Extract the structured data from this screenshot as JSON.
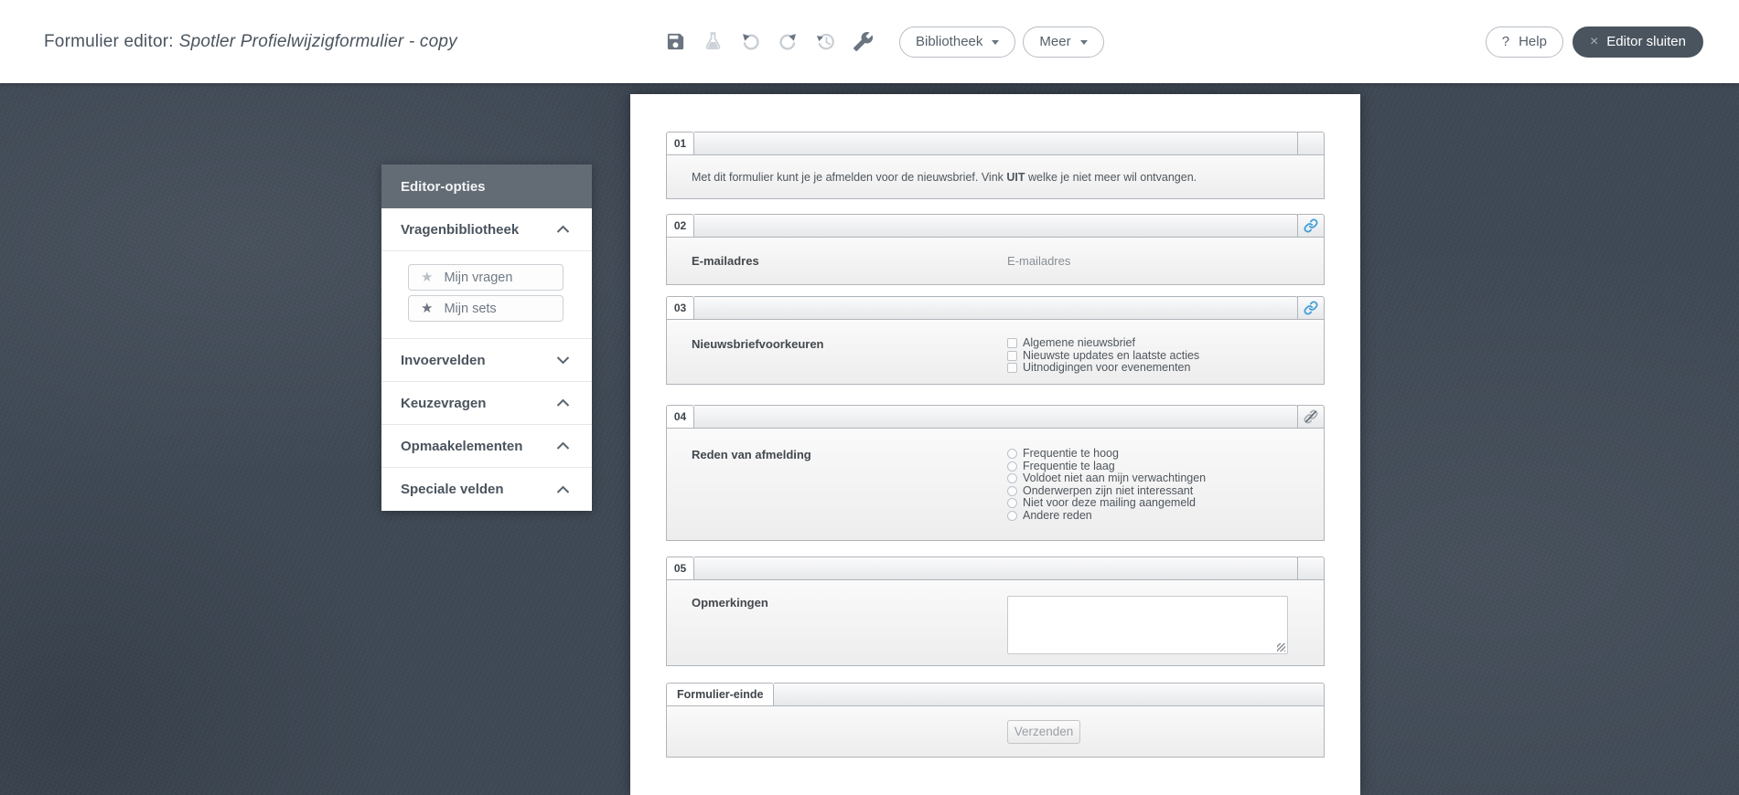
{
  "header": {
    "title_prefix": "Formulier editor:",
    "title_name": "Spotler Profielwijzigformulier - copy",
    "toolbar_icons": [
      "save-icon",
      "flask-icon",
      "undo-icon",
      "redo-icon",
      "history-icon",
      "wrench-icon"
    ],
    "bibliotheek_button": "Bibliotheek",
    "meer_button": "Meer",
    "help_icon": "?",
    "help_button": "Help",
    "close_icon": "×",
    "close_button": "Editor sluiten"
  },
  "sidebar": {
    "title": "Editor-opties",
    "sections": [
      {
        "label": "Vragenbibliotheek",
        "chevron": "up"
      },
      {
        "label": "Invoervelden",
        "chevron": "down"
      },
      {
        "label": "Keuzevragen",
        "chevron": "up"
      },
      {
        "label": "Opmaakelementen",
        "chevron": "up"
      },
      {
        "label": "Speciale velden",
        "chevron": "up"
      }
    ],
    "library_buttons": [
      {
        "label": "Mijn vragen",
        "icon": "star-icon"
      },
      {
        "label": "Mijn sets",
        "icon": "star-icon"
      }
    ]
  },
  "form": {
    "blocks": [
      {
        "num": "01",
        "text_before": "Met dit formulier kunt je je afmelden voor de nieuwsbrief. Vink ",
        "text_bold": "UIT",
        "text_after": " welke je niet meer wil ontvangen."
      },
      {
        "num": "02",
        "icon": "link-icon",
        "label": "E-mailadres",
        "value": "E-mailadres"
      },
      {
        "num": "03",
        "icon": "link-icon",
        "label": "Nieuwsbriefvoorkeuren",
        "options": [
          "Algemene nieuwsbrief",
          "Nieuwste updates en laatste acties",
          "Uitnodigingen voor evenementen"
        ]
      },
      {
        "num": "04",
        "icon": "unlink-icon",
        "label": "Reden van afmelding",
        "options": [
          "Frequentie te hoog",
          "Frequentie te laag",
          "Voldoet niet aan mijn verwachtingen",
          "Onderwerpen zijn niet interessant",
          "Niet voor deze mailing aangemeld",
          "Andere reden"
        ]
      },
      {
        "num": "05",
        "label": "Opmerkingen"
      },
      {
        "num": "Formulier-einde",
        "button": "Verzenden"
      }
    ]
  },
  "colors": {
    "accent_blue": "#3f9fd8",
    "dark_slate": "#4a545e",
    "stage_background": "#3f4955",
    "panel_header": "#636c75"
  }
}
